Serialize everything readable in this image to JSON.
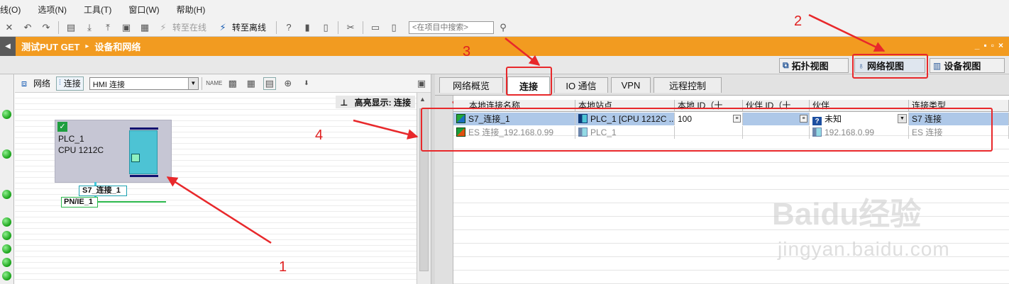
{
  "menu": [
    "线(O)",
    "选项(N)",
    "工具(T)",
    "窗口(W)",
    "帮助(H)"
  ],
  "toolbar": {
    "go_online": "转至在线",
    "go_offline": "转至离线",
    "search_placeholder": "<在项目中搜索>"
  },
  "titlebar": {
    "project": "测试PUT GET",
    "separator": "▸",
    "section": "设备和网络",
    "controls": [
      "_",
      "▪",
      "▫",
      "×"
    ]
  },
  "view_tabs": [
    "拓扑视图",
    "网络视图",
    "设备视图"
  ],
  "left_panel": {
    "toolbar": {
      "network_label": "网络",
      "connection_label": "连接",
      "connection_type": "HMI 连接"
    },
    "highlight": "高亮显示: 连接",
    "plc": {
      "name": "PLC_1",
      "cpu": "CPU 1212C"
    },
    "connection_label": "S7_连接_1",
    "subnet_label": "PN/IE_1"
  },
  "right_panel": {
    "tabs": [
      "网络概览",
      "连接",
      "IO 通信",
      "VPN",
      "远程控制"
    ],
    "active_tab": "连接",
    "columns": [
      "本地连接名称",
      "本地站点",
      "本地 ID（十",
      "伙伴 ID（十",
      "伙伴",
      "连接类型"
    ],
    "rows": [
      {
        "name": "S7_连接_1",
        "station": "PLC_1 [CPU 1212C ...",
        "local_id": "100",
        "partner_id": "",
        "partner": "未知",
        "type": "S7 连接"
      },
      {
        "name": "ES 连接_192.168.0.99",
        "station": "PLC_1",
        "local_id": "",
        "partner_id": "",
        "partner": "192.168.0.99",
        "type": "ES 连接"
      }
    ]
  },
  "annotations": [
    "1",
    "2",
    "3",
    "4"
  ],
  "watermark": {
    "main": "Baidu经验",
    "sub": "jingyan.baidu.com"
  },
  "colors": {
    "accent_orange": "#f29b20",
    "annotation_red": "#e8282b",
    "online_green": "#16a016",
    "selection_blue": "#aec8e8"
  }
}
